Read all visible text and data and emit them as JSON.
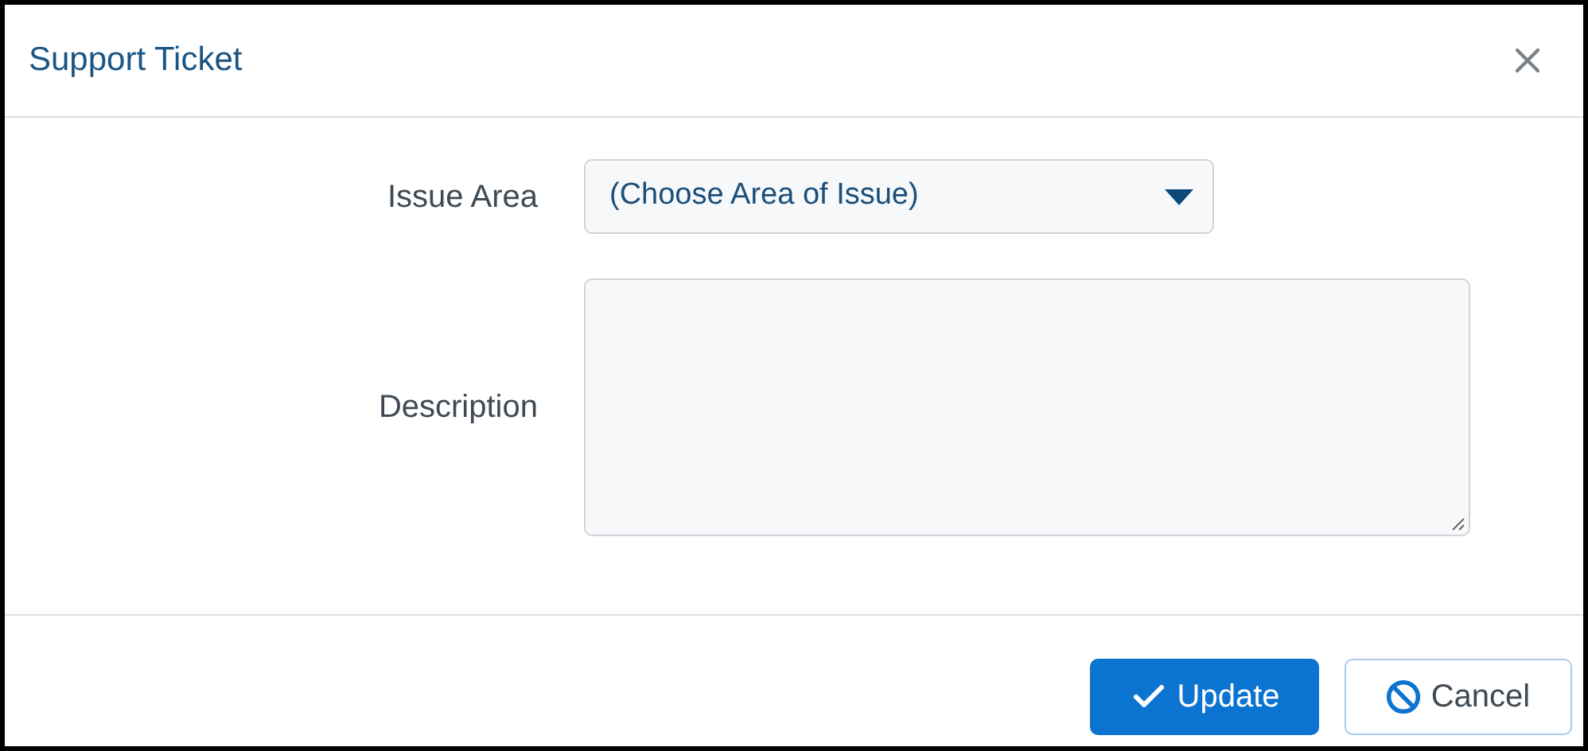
{
  "dialog": {
    "title": "Support Ticket"
  },
  "fields": [
    {
      "kind": "select",
      "label": "Issue Area",
      "value": "(Choose Area of Issue)"
    },
    {
      "kind": "textarea",
      "label": "Description"
    }
  ],
  "buttons": [
    {
      "kind": "primary",
      "label": "Update"
    },
    {
      "kind": "secondary",
      "label": "Cancel"
    }
  ]
}
